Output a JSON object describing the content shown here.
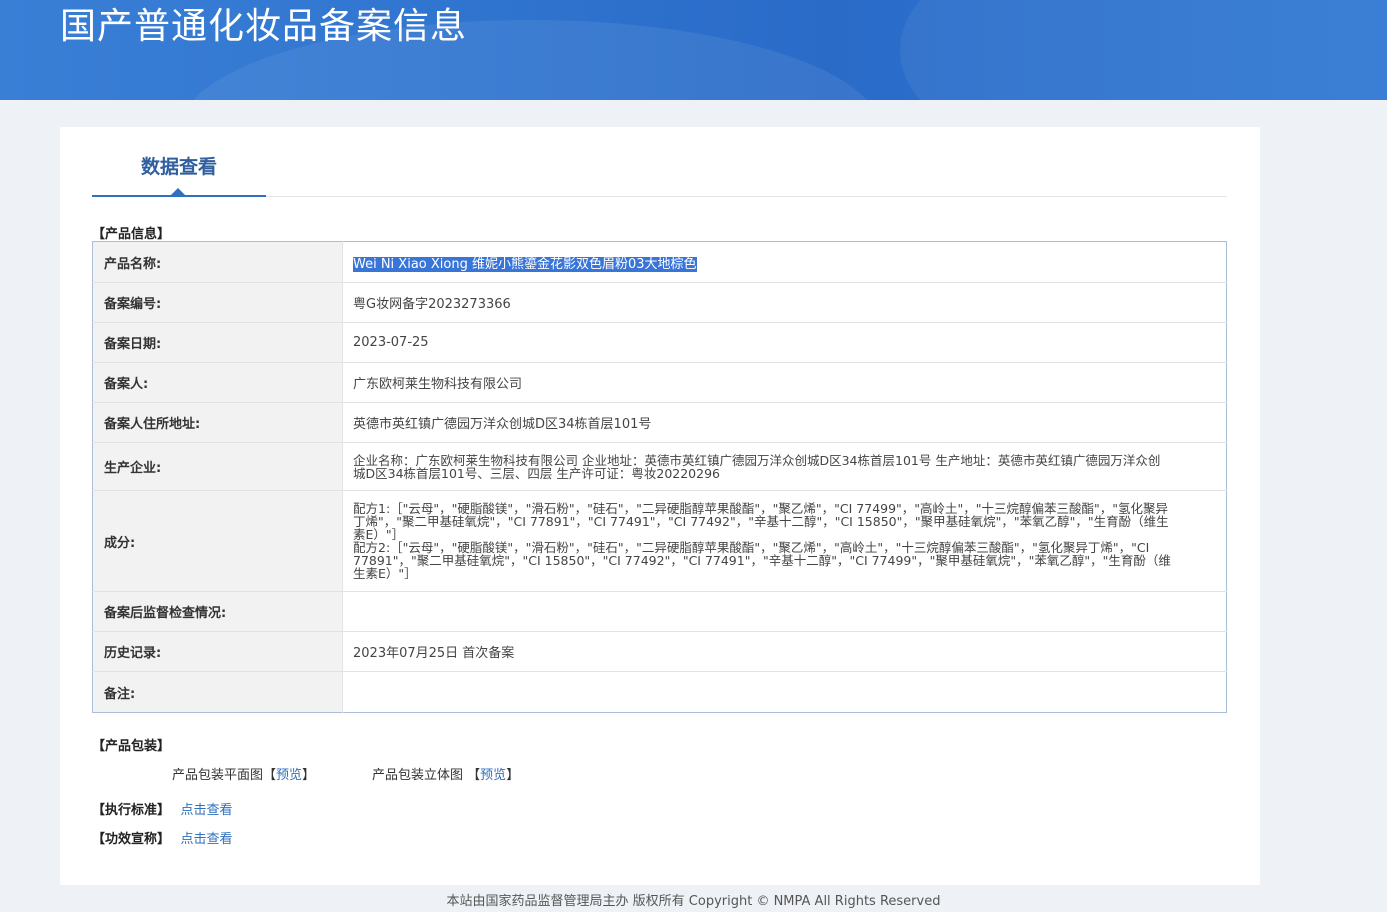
{
  "banner": {
    "title": "国产普通化妆品备案信息"
  },
  "tabs": {
    "active": "数据查看"
  },
  "product_info": {
    "section_title": "【产品信息】",
    "rows": [
      {
        "key": "产品名称:",
        "value": "Wei Ni Xiao Xiong 维妮小熊鎏金花影双色眉粉03大地棕色"
      },
      {
        "key": "备案编号:",
        "value": "粤G妆网备字2023273366"
      },
      {
        "key": "备案日期:",
        "value": "2023-07-25"
      },
      {
        "key": "备案人:",
        "value": "广东欧柯莱生物科技有限公司"
      },
      {
        "key": "备案人住所地址:",
        "value": "英德市英红镇广德园万洋众创城D区34栋首层101号"
      },
      {
        "key": "生产企业:",
        "value": "企业名称：广东欧柯莱生物科技有限公司 企业地址：英德市英红镇广德园万洋众创城D区34栋首层101号 生产地址：英德市英红镇广德园万洋众创城D区34栋首层101号、三层、四层 生产许可证：粤妆20220296"
      },
      {
        "key": "成分:",
        "value_lines": [
          "配方1:［\"云母\"，\"硬脂酸镁\"，\"滑石粉\"，\"硅石\"，\"二异硬脂醇苹果酸酯\"，\"聚乙烯\"，\"CI 77499\"，\"高岭土\"，\"十三烷醇偏苯三酸酯\"，\"氢化聚异丁烯\"，\"聚二甲基硅氧烷\"，\"CI 77891\"，\"CI 77491\"，\"CI 77492\"，\"辛基十二醇\"，\"CI 15850\"，\"聚甲基硅氧烷\"，\"苯氧乙醇\"，\"生育酚（维生素E）\"］",
          "配方2:［\"云母\"，\"硬脂酸镁\"，\"滑石粉\"，\"硅石\"，\"二异硬脂醇苹果酸酯\"，\"聚乙烯\"，\"高岭土\"，\"十三烷醇偏苯三酸酯\"，\"氢化聚异丁烯\"，\"CI 77891\"，\"聚二甲基硅氧烷\"，\"CI 15850\"，\"CI 77492\"，\"CI 77491\"，\"辛基十二醇\"，\"CI 77499\"，\"聚甲基硅氧烷\"，\"苯氧乙醇\"，\"生育酚（维生素E）\"］"
        ]
      },
      {
        "key": "备案后监督检查情况:",
        "value": ""
      },
      {
        "key": "历史记录:",
        "value": "2023年07月25日 首次备案"
      },
      {
        "key": "备注:",
        "value": ""
      }
    ]
  },
  "packaging": {
    "section_title": "【产品包装】",
    "flat_label": "产品包装平面图",
    "flat_link": "预览",
    "three_d_label": "产品包装立体图",
    "three_d_link": "预览",
    "open_bracket": "【",
    "close_bracket": "】"
  },
  "standard": {
    "section_title": "【执行标准】",
    "link": "点击查看"
  },
  "efficacy": {
    "section_title": "【功效宣称】",
    "link": "点击查看"
  },
  "footer": {
    "text": "本站由国家药品监督管理局主办 版权所有 Copyright © NMPA All Rights Reserved"
  }
}
